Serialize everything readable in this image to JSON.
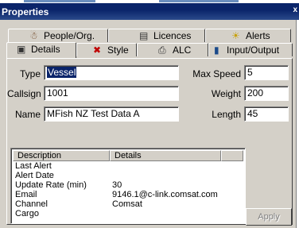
{
  "window": {
    "title": "Properties",
    "close_glyph": "x"
  },
  "tabs_back": [
    {
      "icon": "people-org-icon",
      "label": "People/Org."
    },
    {
      "icon": "licences-icon",
      "label": "Licences"
    },
    {
      "icon": "alerts-icon",
      "label": "Alerts"
    }
  ],
  "tabs_front": [
    {
      "icon": "details-icon",
      "label": "Details",
      "active": true
    },
    {
      "icon": "style-icon",
      "label": "Style"
    },
    {
      "icon": "alc-icon",
      "label": "ALC"
    },
    {
      "icon": "input-output-icon",
      "label": "Input/Output"
    }
  ],
  "form": {
    "type_label": "Type",
    "type_value": "Vessel",
    "callsign_label": "Callsign",
    "callsign_value": "1001",
    "name_label": "Name",
    "name_value": "MFish NZ Test Data A",
    "maxspeed_label": "Max Speed",
    "maxspeed_value": "5",
    "weight_label": "Weight",
    "weight_value": "200",
    "length_label": "Length",
    "length_value": "45"
  },
  "listview": {
    "columns": [
      "Description",
      "Details"
    ],
    "rows": [
      {
        "description": "Last Alert",
        "details": ""
      },
      {
        "description": "Alert Date",
        "details": ""
      },
      {
        "description": "Update Rate (min)",
        "details": "30"
      },
      {
        "description": "Email",
        "details": "9146.1@c-link.comsat.com"
      },
      {
        "description": "Channel",
        "details": "Comsat"
      },
      {
        "description": "Cargo",
        "details": ""
      }
    ]
  },
  "buttons": {
    "apply": "Apply"
  },
  "colors": {
    "titlebar": "#0a246a",
    "face": "#d4d0c8",
    "selection": "#0a246a"
  }
}
